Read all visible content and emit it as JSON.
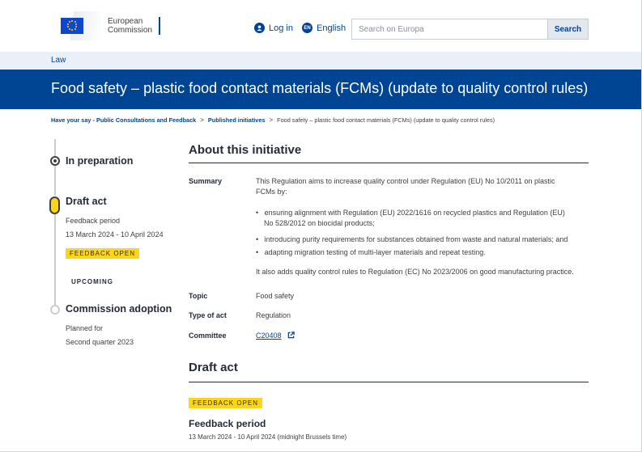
{
  "header": {
    "logo_line1": "European",
    "logo_line2": "Commission",
    "login_label": "Log in",
    "lang_code": "EN",
    "lang_label": "English",
    "search_placeholder": "Search on Europa",
    "search_button": "Search"
  },
  "lawbar": {
    "label": "Law"
  },
  "page_title": "Food safety – plastic food contact materials (FCMs) (update to quality control rules)",
  "breadcrumb": [
    "Have your say - Public Consultations and Feedback",
    "Published initiatives",
    "Food safety – plastic food contact materials (FCMs) (update to quality control rules)"
  ],
  "breadcrumb_separator": ">",
  "timeline": {
    "preparation": {
      "title": "In preparation"
    },
    "draft": {
      "title": "Draft act",
      "period_label": "Feedback period",
      "dates": "13 March 2024 - 10 April 2024",
      "badge": "FEEDBACK OPEN"
    },
    "upcoming_label": "UPCOMING",
    "adoption": {
      "title": "Commission adoption",
      "planned_label": "Planned for",
      "planned_value": "Second quarter 2023"
    }
  },
  "about": {
    "heading": "About this initiative",
    "summary_label": "Summary",
    "summary_intro_1": "This Regulation aims to increase quality control under Regulation (EU) No 10/2011 on plastic",
    "summary_intro_2": "FCMs by:",
    "bullets": [
      {
        "line1": "ensuring alignment with Regulation (EU) 2022/1616 on recycled plastics and Regulation (EU)",
        "line2": "No 528/2012 on biocidal products;"
      },
      {
        "line1": "introducing purity requirements for substances obtained from waste and natural materials; and",
        "line2": ""
      },
      {
        "line1": "adapting migration testing of multi-layer materials and repeat testing.",
        "line2": ""
      }
    ],
    "summary_outro": "It also adds quality control rules to Regulation (EC) No 2023/2006 on good manufacturing practice.",
    "topic_label": "Topic",
    "topic_value": "Food safety",
    "type_label": "Type of act",
    "type_value": "Regulation",
    "committee_label": "Committee",
    "committee_value": "C20408"
  },
  "draft_section": {
    "heading": "Draft act",
    "badge": "FEEDBACK OPEN",
    "period_title": "Feedback period",
    "period_dates": "13 March 2024 - 10 April 2024  (midnight Brussels time)"
  },
  "colors": {
    "brand_blue": "#004494",
    "badge_yellow": "#ffd617",
    "law_bar": "#eaf0f8"
  },
  "icons": [
    "user-icon",
    "language-icon",
    "external-link-icon",
    "eu-flag-icon"
  ]
}
